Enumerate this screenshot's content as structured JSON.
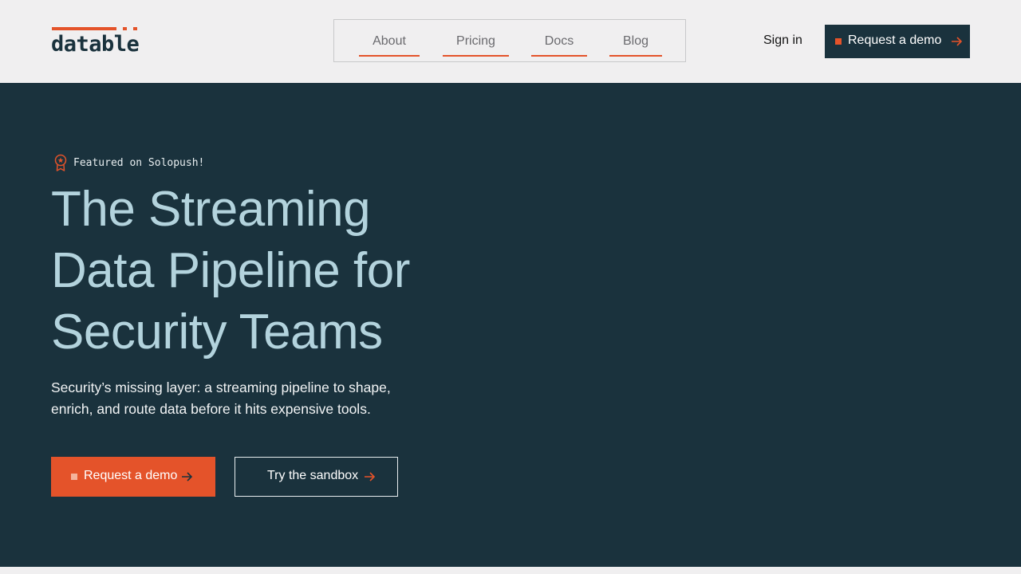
{
  "colors": {
    "brand_orange": "#e4532a",
    "dark_teal": "#1a323d",
    "hero_title": "#b3d3dd",
    "header_bg": "#f0eff0"
  },
  "header": {
    "logo_text": "datable",
    "nav": [
      {
        "label": "About"
      },
      {
        "label": "Pricing"
      },
      {
        "label": "Docs"
      },
      {
        "label": "Blog"
      }
    ],
    "sign_in": "Sign in",
    "cta_label": "Request a demo",
    "cta_icon": "arrow-right-icon"
  },
  "hero": {
    "badge_icon": "award-ribbon-icon",
    "badge_text": "Featured on Solopush!",
    "title_lines": [
      "The Streaming",
      "Data Pipeline for",
      "Security Teams"
    ],
    "subtitle": "Security’s missing layer: a streaming pipeline to shape, enrich, and route data before it hits expensive tools.",
    "primary_button": "Request a demo",
    "secondary_button": "Try the sandbox"
  }
}
